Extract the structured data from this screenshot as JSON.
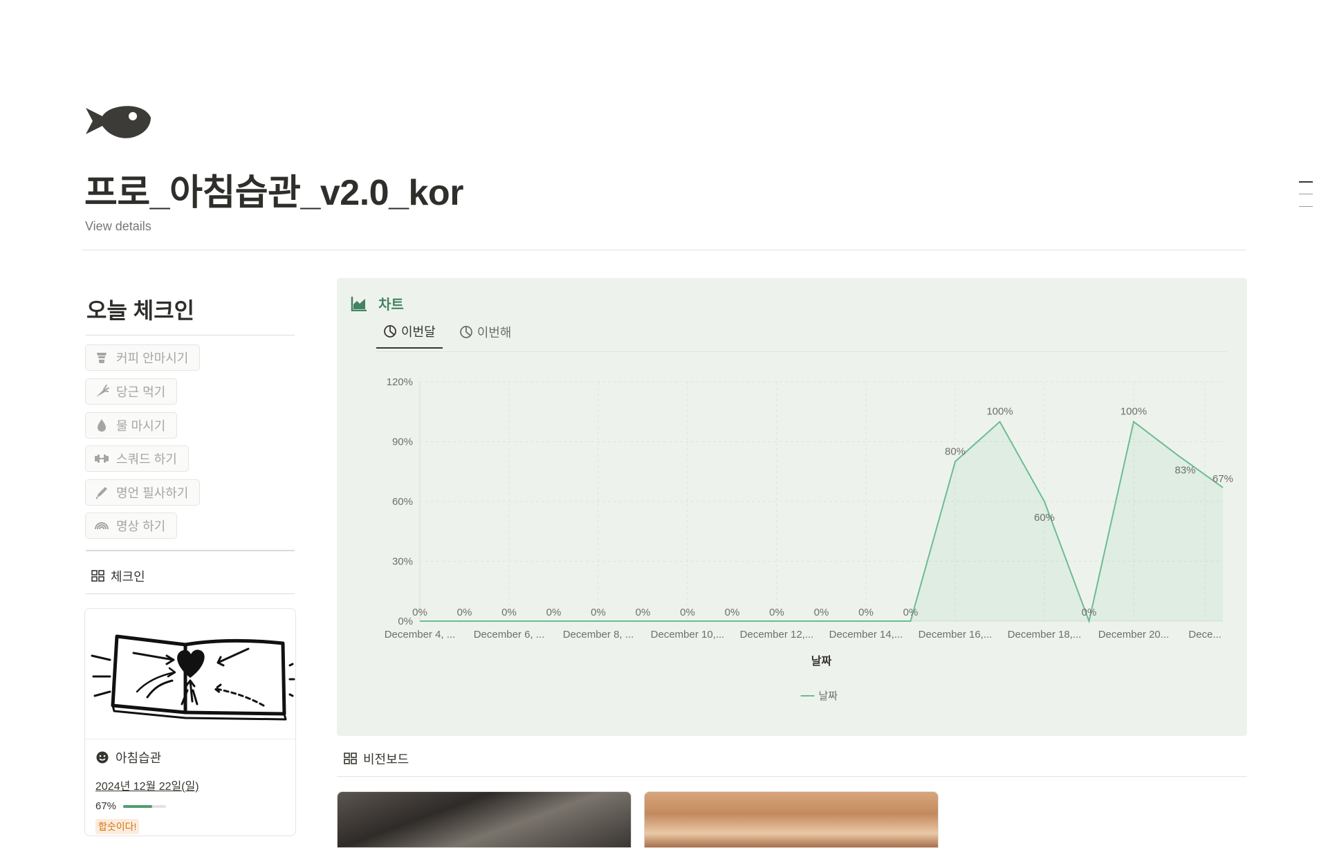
{
  "page": {
    "title": "프로_아침습관_v2.0_kor",
    "view_details": "View details",
    "icon": "fish-icon"
  },
  "today_checkin": {
    "heading": "오늘 체크인",
    "habits": [
      {
        "label": "커피 안마시기",
        "icon": "coffee-cup-icon"
      },
      {
        "label": "당근 먹기",
        "icon": "carrot-icon"
      },
      {
        "label": "물 마시기",
        "icon": "water-drop-icon"
      },
      {
        "label": "스쿼드 하기",
        "icon": "dumbbell-icon"
      },
      {
        "label": "명언 필사하기",
        "icon": "pen-icon"
      },
      {
        "label": "명상 하기",
        "icon": "rainbow-icon"
      }
    ],
    "view_tab": "체크인",
    "card": {
      "title": "아침습관",
      "date": "2024년 12월 22일(일)",
      "progress_label": "67%",
      "progress_value": 0.67,
      "status": "합숫이다!"
    }
  },
  "chart_panel": {
    "title": "차트",
    "tabs": [
      {
        "label": "이번달",
        "active": true
      },
      {
        "label": "이번해",
        "active": false
      }
    ]
  },
  "chart_data": {
    "type": "area",
    "xlabel": "날짜",
    "ylabel": "",
    "ylim": [
      0,
      120
    ],
    "yticks": [
      "0%",
      "30%",
      "60%",
      "90%",
      "120%"
    ],
    "ytick_values": [
      0,
      30,
      60,
      90,
      120
    ],
    "x_tick_labels": [
      "December 4, ...",
      "December 6, ...",
      "December 8, ...",
      "December 10,...",
      "December 12,...",
      "December 14,...",
      "December 16,...",
      "December 18,...",
      "December 20...",
      "Dece..."
    ],
    "x_tick_indices": [
      0,
      2,
      4,
      6,
      8,
      10,
      12,
      14,
      16,
      17.6
    ],
    "values": [
      0,
      0,
      0,
      0,
      0,
      0,
      0,
      0,
      0,
      0,
      0,
      0,
      80,
      100,
      60,
      0,
      100,
      83,
      67
    ],
    "value_labels": [
      "0%",
      "0%",
      "0%",
      "0%",
      "0%",
      "0%",
      "0%",
      "0%",
      "0%",
      "0%",
      "0%",
      "0%",
      "80%",
      "100%",
      "60%",
      "0%",
      "100%",
      "83%",
      "67%"
    ],
    "series": [
      {
        "name": "날짜"
      }
    ],
    "grid": true,
    "legend": "bottom-center",
    "colors": {
      "line": "#6dbb91",
      "fill": "#6dbb91"
    }
  },
  "vision_board": {
    "view_tab": "비전보드"
  }
}
